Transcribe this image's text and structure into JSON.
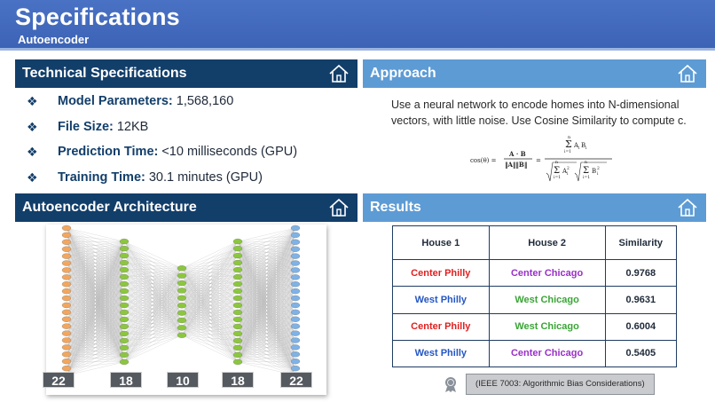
{
  "header": {
    "title": "Specifications",
    "subtitle": "Autoencoder"
  },
  "sections": {
    "tech_specs": "Technical Specifications",
    "approach": "Approach",
    "architecture": "Autoencoder Architecture",
    "results": "Results"
  },
  "specs": [
    {
      "label": "Model Parameters:",
      "value": "1,568,160"
    },
    {
      "label": "File Size:",
      "value": "12KB"
    },
    {
      "label": "Prediction Time:",
      "value": "<10 milliseconds (GPU)"
    },
    {
      "label": "Training Time:",
      "value": "30.1 minutes (GPU)"
    }
  ],
  "approach": {
    "text": "Use a neural network to encode homes into N-dimensional vectors, with little noise. Use Cosine Similarity to compute c."
  },
  "architecture": {
    "layers": [
      {
        "units": "22",
        "color": "#f2a65e"
      },
      {
        "units": "18",
        "color": "#8cc63f"
      },
      {
        "units": "10",
        "color": "#8cc63f"
      },
      {
        "units": "18",
        "color": "#8cc63f"
      },
      {
        "units": "22",
        "color": "#7fb2e5"
      }
    ]
  },
  "results": {
    "headers": [
      "House 1",
      "House 2",
      "Similarity"
    ],
    "rows": [
      {
        "house1": "Center Philly",
        "house1_color": "#e02020",
        "house2": "Center Chicago",
        "house2_color": "#9a2fc8",
        "similarity": "0.9768"
      },
      {
        "house1": "West Philly",
        "house1_color": "#2456c4",
        "house2": "West Chicago",
        "house2_color": "#3aa536",
        "similarity": "0.9631"
      },
      {
        "house1": "Center Philly",
        "house1_color": "#e02020",
        "house2": "West Chicago",
        "house2_color": "#3aa536",
        "similarity": "0.6004"
      },
      {
        "house1": "West Philly",
        "house1_color": "#2456c4",
        "house2": "Center Chicago",
        "house2_color": "#9a2fc8",
        "similarity": "0.5405"
      }
    ]
  },
  "footer": {
    "ieee_label": "(IEEE 7003: Algorithmic Bias Considerations)"
  },
  "icons": {
    "section": "house-icon",
    "badge": "award-badge-icon"
  }
}
